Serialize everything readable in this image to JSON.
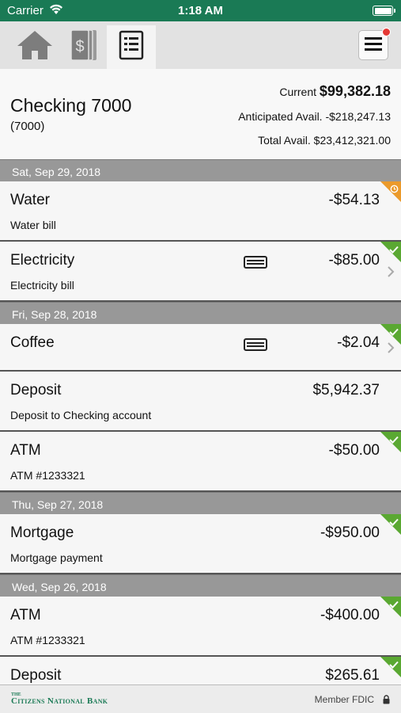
{
  "status_bar": {
    "carrier": "Carrier",
    "time": "1:18 AM"
  },
  "nav": {
    "tabs": [
      {
        "name": "home-icon"
      },
      {
        "name": "money-icon"
      },
      {
        "name": "register-icon"
      }
    ],
    "menu_icon": "hamburger-menu-icon",
    "notification_color": "#e53935"
  },
  "account": {
    "name": "Checking 7000",
    "number": "(7000)",
    "current_label": "Current",
    "current_value": "$99,382.18",
    "anticipated_label": "Anticipated Avail.",
    "anticipated_value": "-$218,247.13",
    "total_label": "Total Avail.",
    "total_value": "$23,412,321.00"
  },
  "groups": [
    {
      "date": "Sat, Sep 29, 2018",
      "items": [
        {
          "title": "Water",
          "amount": "-$54.13",
          "sub": "Water bill",
          "status": "pending"
        },
        {
          "title": "Electricity",
          "amount": "-$85.00",
          "sub": "Electricity bill",
          "status": "cleared",
          "card": true,
          "chevron": true
        }
      ]
    },
    {
      "date": "Fri, Sep 28, 2018",
      "items": [
        {
          "title": "Coffee",
          "amount": "-$2.04",
          "sub": "",
          "status": "cleared",
          "card": true,
          "chevron": true
        },
        {
          "title": "Deposit",
          "amount": "$5,942.37",
          "sub": "Deposit to Checking account",
          "status": "none"
        },
        {
          "title": "ATM",
          "amount": "-$50.00",
          "sub": "ATM #1233321",
          "status": "cleared"
        }
      ]
    },
    {
      "date": "Thu, Sep 27, 2018",
      "items": [
        {
          "title": "Mortgage",
          "amount": "-$950.00",
          "sub": "Mortgage payment",
          "status": "cleared"
        }
      ]
    },
    {
      "date": "Wed, Sep 26, 2018",
      "items": [
        {
          "title": "ATM",
          "amount": "-$400.00",
          "sub": "ATM #1233321",
          "status": "cleared"
        },
        {
          "title": "Deposit",
          "amount": "$265.61",
          "sub": "",
          "status": "cleared"
        }
      ]
    }
  ],
  "footer": {
    "logo_the": "THE",
    "logo_name": "Citizens National Bank",
    "fdic": "Member FDIC"
  },
  "colors": {
    "brand": "#1a7a55",
    "cleared": "#5aa832",
    "pending": "#eb9a2b"
  }
}
